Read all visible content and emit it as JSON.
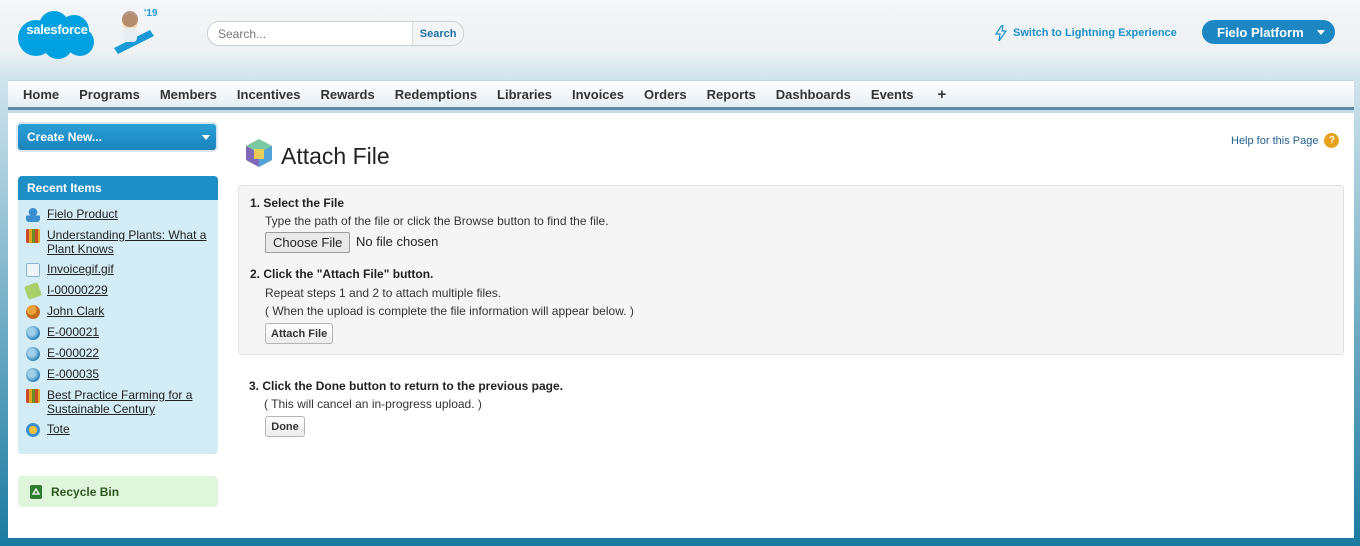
{
  "header": {
    "logo_text": "salesforce",
    "release_badge": "'19",
    "search_placeholder": "Search...",
    "search_button": "Search",
    "lightning_link": "Switch to Lightning Experience",
    "app_menu": "Fielo Platform"
  },
  "tabs": [
    "Home",
    "Programs",
    "Members",
    "Incentives",
    "Rewards",
    "Redemptions",
    "Libraries",
    "Invoices",
    "Orders",
    "Reports",
    "Dashboards",
    "Events",
    "+"
  ],
  "sidebar": {
    "create_new": "Create New...",
    "recent_title": "Recent Items",
    "recent_items": [
      {
        "label": "Fielo Product",
        "icon": "product-icon"
      },
      {
        "label": "Understanding Plants: What a Plant Knows",
        "icon": "library-icon"
      },
      {
        "label": "Invoicegif.gif",
        "icon": "file-icon"
      },
      {
        "label": "I-00000229",
        "icon": "invoice-icon"
      },
      {
        "label": "John Clark",
        "icon": "member-icon"
      },
      {
        "label": "E-000021",
        "icon": "event-icon"
      },
      {
        "label": "E-000022",
        "icon": "event-icon"
      },
      {
        "label": "E-000035",
        "icon": "event-icon"
      },
      {
        "label": "Best Practice Farming for a Sustainable Century",
        "icon": "library-icon"
      },
      {
        "label": "Tote",
        "icon": "reward-icon"
      }
    ],
    "recycle_bin": "Recycle Bin"
  },
  "main": {
    "title": "Attach File",
    "help_link": "Help for this Page",
    "help_icon": "?",
    "step1": {
      "title": "1.  Select the File",
      "text": "Type the path of the file or click the Browse button to find the file.",
      "choose_button": "Choose File",
      "file_status": "No file chosen"
    },
    "step2": {
      "title": "2.  Click the \"Attach File\" button.",
      "text1": "Repeat steps 1 and 2 to attach multiple files.",
      "text2": "( When the upload is complete the file information will appear below. )",
      "button": "Attach File"
    },
    "step3": {
      "title": "3.  Click the Done button to return to the previous page.",
      "text": "( This will cancel an in-progress upload. )",
      "button": "Done"
    }
  }
}
